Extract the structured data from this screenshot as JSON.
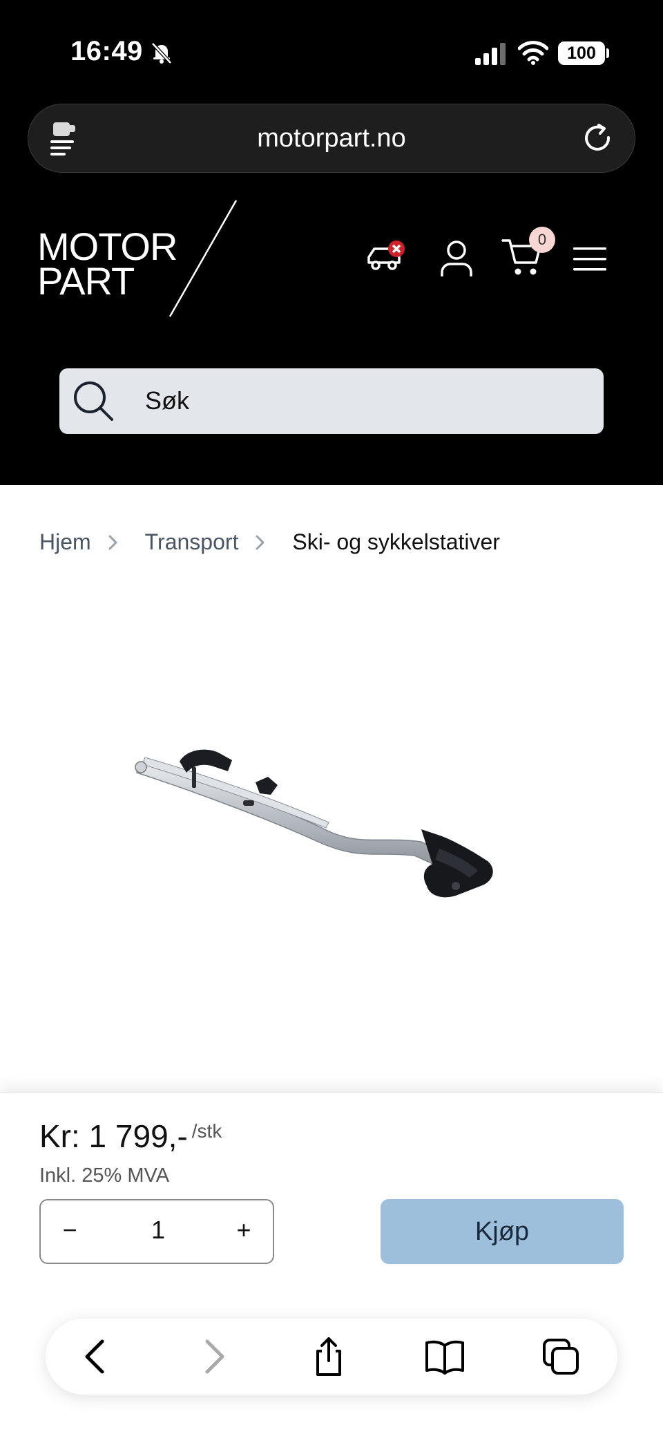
{
  "status_bar": {
    "time": "16:49",
    "battery": "100"
  },
  "browser": {
    "url": "motorpart.no"
  },
  "site": {
    "logo_line1": "MOTOR",
    "logo_line2": "PART",
    "cart_count": "0",
    "search_placeholder": "Søk"
  },
  "breadcrumb": [
    {
      "label": "Hjem"
    },
    {
      "label": "Transport"
    },
    {
      "label": "Ski- og sykkelstativer"
    }
  ],
  "product": {
    "price": "Kr: 1 799,-",
    "unit": "/stk",
    "vat_note": "Inkl. 25% MVA",
    "quantity": "1",
    "minus": "−",
    "plus": "+",
    "buy_label": "Kjøp"
  },
  "colors": {
    "header_bg": "#000000",
    "search_bg": "#e3e6ea",
    "buy_button": "#9dbfdc",
    "cart_badge": "#f8d6d3",
    "vehicle_remove_badge": "#d0202a"
  },
  "icons": [
    "bell-slash-icon",
    "signal-icon",
    "wifi-icon",
    "tabs-icon",
    "reload-icon",
    "car-remove-icon",
    "user-icon",
    "cart-icon",
    "menu-icon",
    "search-icon",
    "back-icon",
    "forward-icon",
    "share-icon",
    "bookmarks-icon",
    "tabs-overview-icon"
  ]
}
